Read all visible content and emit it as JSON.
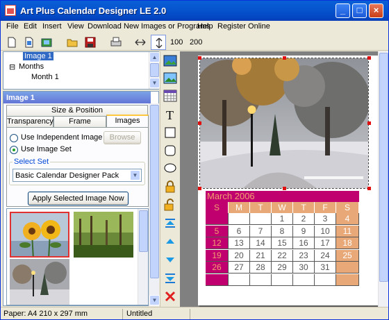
{
  "window": {
    "title": "Art Plus Calendar Designer LE 2.0",
    "controls": [
      "_",
      "□",
      "×"
    ]
  },
  "menu": [
    "File",
    "Edit",
    "Insert",
    "View",
    "Download New Images or Programs",
    "Help",
    "Register Online"
  ],
  "toolbar": {
    "zoom_100": "100",
    "zoom_200": "200"
  },
  "tree": {
    "items": [
      {
        "label": "Image 1",
        "selected": true
      },
      {
        "label": "Months",
        "expander": "⊟"
      },
      {
        "label": "Month 1"
      }
    ]
  },
  "panel": {
    "header": "Image 1",
    "tabs_top": [
      "Size & Position"
    ],
    "tabs_bottom": [
      "Transparency",
      "Frame",
      "Images"
    ],
    "active_tab": "Images",
    "radio_independent": "Use Independent Image",
    "radio_set": "Use Image Set",
    "browse_label": "Browse",
    "select_set_label": "Select Set",
    "select_set_value": "Basic Calendar Designer Pack",
    "apply_label": "Apply Selected Image Now"
  },
  "calendar": {
    "month_title": "March 2006",
    "day_headers": [
      "S",
      "M",
      "T",
      "W",
      "T",
      "F",
      "S"
    ],
    "weeks": [
      [
        "",
        "",
        "",
        "1",
        "2",
        "3",
        "4"
      ],
      [
        "5",
        "6",
        "7",
        "8",
        "9",
        "10",
        "11"
      ],
      [
        "12",
        "13",
        "14",
        "15",
        "16",
        "17",
        "18"
      ],
      [
        "19",
        "20",
        "21",
        "22",
        "23",
        "24",
        "25"
      ],
      [
        "26",
        "27",
        "28",
        "29",
        "30",
        "31",
        ""
      ],
      [
        "",
        "",
        "",
        "",
        "",
        "",
        ""
      ]
    ],
    "colors": {
      "header_bg": "#C0006E",
      "header_text": "#F2A070",
      "sunday_bg": "#C0006E",
      "saturday_bg": "#E8A878",
      "weekday_hdr_bg": "#E8A878"
    }
  },
  "status": {
    "paper": "Paper: A4 210 x 297 mm",
    "doc": "Untitled"
  },
  "icons": {
    "toolbar": [
      "new-icon",
      "new-page-icon",
      "gallery-icon",
      "open-icon",
      "save-icon",
      "print-icon",
      "fit-width-icon",
      "fit-height-icon"
    ],
    "vertical": [
      "insert-image-icon",
      "insert-clipart-icon",
      "insert-calendar-icon",
      "insert-text-icon",
      "rectangle-icon",
      "rounded-rect-icon",
      "ellipse-icon",
      "lock-icon",
      "unlock-icon",
      "bring-to-front-icon",
      "bring-forward-icon",
      "send-backward-icon",
      "send-to-back-icon",
      "delete-icon"
    ]
  }
}
